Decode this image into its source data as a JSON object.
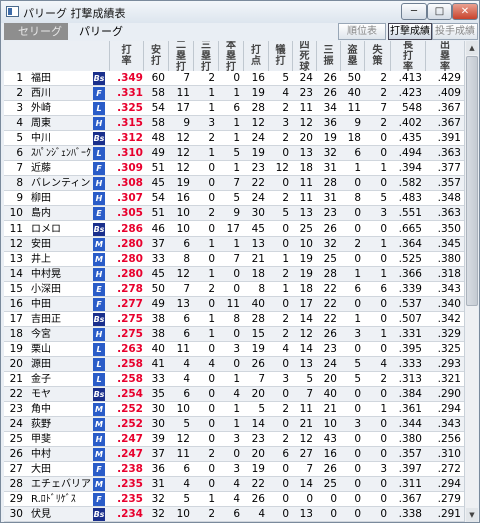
{
  "window": {
    "title": "パリーグ 打撃成績表",
    "min": "─",
    "max": "□",
    "close": "✕"
  },
  "toolbar": {
    "rank_table": "順位表",
    "batting": "打撃成績",
    "pitching": "投手成績"
  },
  "league": {
    "selector": "セリーグ",
    "current": "パリーグ"
  },
  "columns": [
    "打率",
    "安打",
    "二塁打",
    "三塁打",
    "本塁打",
    "打点",
    "犠打",
    "四死球",
    "三振",
    "盗塁",
    "失策",
    "長打率",
    "出塁率"
  ],
  "pos_colors": {
    "Bs": "#1a2f8c",
    "F": "#2a5cc8",
    "L": "#2a5cc8",
    "H": "#2a5cc8",
    "E": "#2a5cc8",
    "M": "#2a5cc8"
  },
  "rows": [
    {
      "rank": "1",
      "name": "福田",
      "team": "Bs",
      "avg": ".349",
      "v": [
        "60",
        "7",
        "2",
        "0",
        "16",
        "5",
        "24",
        "26",
        "50",
        "2",
        ".413",
        ".429"
      ]
    },
    {
      "rank": "2",
      "name": "西川",
      "team": "F",
      "avg": ".331",
      "v": [
        "58",
        "11",
        "1",
        "1",
        "19",
        "4",
        "23",
        "26",
        "40",
        "2",
        ".423",
        ".409"
      ]
    },
    {
      "rank": "3",
      "name": "外崎",
      "team": "L",
      "avg": ".325",
      "v": [
        "54",
        "17",
        "1",
        "6",
        "28",
        "2",
        "11",
        "34",
        "11",
        "7",
        "548",
        ".367"
      ]
    },
    {
      "rank": "4",
      "name": "周東",
      "team": "H",
      "avg": ".315",
      "v": [
        "58",
        "9",
        "3",
        "1",
        "12",
        "3",
        "12",
        "36",
        "9",
        "2",
        ".402",
        ".367"
      ]
    },
    {
      "rank": "5",
      "name": "中川",
      "team": "Bs",
      "avg": ".312",
      "v": [
        "48",
        "12",
        "2",
        "1",
        "24",
        "2",
        "20",
        "19",
        "18",
        "0",
        ".435",
        ".391"
      ]
    },
    {
      "rank": "6",
      "name": "ｽﾊﾟﾝｼﾞｪﾝﾊﾞｰｸﾞ",
      "team": "L",
      "avg": ".310",
      "v": [
        "49",
        "12",
        "1",
        "5",
        "19",
        "0",
        "13",
        "32",
        "6",
        "0",
        ".494",
        ".363"
      ]
    },
    {
      "rank": "7",
      "name": "近藤",
      "team": "F",
      "avg": ".309",
      "v": [
        "51",
        "12",
        "0",
        "1",
        "23",
        "12",
        "18",
        "31",
        "1",
        "1",
        ".394",
        ".377"
      ]
    },
    {
      "rank": "8",
      "name": "バレンティン",
      "team": "H",
      "avg": ".308",
      "v": [
        "45",
        "19",
        "0",
        "7",
        "22",
        "0",
        "11",
        "28",
        "0",
        "0",
        ".582",
        ".357"
      ]
    },
    {
      "rank": "9",
      "name": "柳田",
      "team": "H",
      "avg": ".307",
      "v": [
        "54",
        "16",
        "0",
        "5",
        "24",
        "2",
        "11",
        "31",
        "8",
        "5",
        ".483",
        ".348"
      ]
    },
    {
      "rank": "10",
      "name": "島内",
      "team": "E",
      "avg": ".305",
      "v": [
        "51",
        "10",
        "2",
        "9",
        "30",
        "5",
        "13",
        "23",
        "0",
        "3",
        ".551",
        ".363"
      ]
    },
    {
      "rank": "11",
      "name": "ロメロ",
      "team": "Bs",
      "avg": ".286",
      "v": [
        "46",
        "10",
        "0",
        "17",
        "45",
        "0",
        "25",
        "26",
        "0",
        "0",
        ".665",
        ".350"
      ]
    },
    {
      "rank": "12",
      "name": "安田",
      "team": "M",
      "avg": ".280",
      "v": [
        "37",
        "6",
        "1",
        "1",
        "13",
        "0",
        "10",
        "32",
        "2",
        "1",
        ".364",
        ".345"
      ]
    },
    {
      "rank": "13",
      "name": "井上",
      "team": "M",
      "avg": ".280",
      "v": [
        "33",
        "8",
        "0",
        "7",
        "21",
        "1",
        "19",
        "25",
        "0",
        "0",
        ".525",
        ".380"
      ]
    },
    {
      "rank": "14",
      "name": "中村晃",
      "team": "H",
      "avg": ".280",
      "v": [
        "45",
        "12",
        "1",
        "0",
        "18",
        "2",
        "19",
        "28",
        "1",
        "1",
        ".366",
        ".318"
      ]
    },
    {
      "rank": "15",
      "name": "小深田",
      "team": "E",
      "avg": ".278",
      "v": [
        "50",
        "7",
        "2",
        "0",
        "8",
        "1",
        "18",
        "22",
        "6",
        "6",
        ".339",
        ".343"
      ]
    },
    {
      "rank": "16",
      "name": "中田",
      "team": "F",
      "avg": ".277",
      "v": [
        "49",
        "13",
        "0",
        "11",
        "40",
        "0",
        "17",
        "22",
        "0",
        "0",
        ".537",
        ".340"
      ]
    },
    {
      "rank": "17",
      "name": "吉田正",
      "team": "Bs",
      "avg": ".275",
      "v": [
        "38",
        "6",
        "1",
        "8",
        "28",
        "2",
        "14",
        "22",
        "1",
        "0",
        ".507",
        ".342"
      ]
    },
    {
      "rank": "18",
      "name": "今宮",
      "team": "H",
      "avg": ".275",
      "v": [
        "38",
        "6",
        "1",
        "0",
        "15",
        "2",
        "12",
        "26",
        "3",
        "1",
        ".331",
        ".329"
      ]
    },
    {
      "rank": "19",
      "name": "栗山",
      "team": "L",
      "avg": ".263",
      "v": [
        "40",
        "11",
        "0",
        "3",
        "19",
        "4",
        "14",
        "23",
        "0",
        "0",
        ".395",
        ".325"
      ]
    },
    {
      "rank": "20",
      "name": "源田",
      "team": "L",
      "avg": ".258",
      "v": [
        "41",
        "4",
        "4",
        "0",
        "26",
        "0",
        "13",
        "24",
        "5",
        "4",
        ".333",
        ".293"
      ]
    },
    {
      "rank": "21",
      "name": "金子",
      "team": "L",
      "avg": ".258",
      "v": [
        "33",
        "4",
        "0",
        "1",
        "7",
        "3",
        "5",
        "20",
        "5",
        "2",
        ".313",
        ".321"
      ]
    },
    {
      "rank": "22",
      "name": "モヤ",
      "team": "Bs",
      "avg": ".254",
      "v": [
        "35",
        "6",
        "0",
        "4",
        "20",
        "0",
        "7",
        "40",
        "0",
        "0",
        ".384",
        ".290"
      ]
    },
    {
      "rank": "23",
      "name": "角中",
      "team": "M",
      "avg": ".252",
      "v": [
        "30",
        "10",
        "0",
        "1",
        "5",
        "2",
        "11",
        "21",
        "0",
        "1",
        ".361",
        ".294"
      ]
    },
    {
      "rank": "24",
      "name": "荻野",
      "team": "M",
      "avg": ".252",
      "v": [
        "30",
        "5",
        "0",
        "1",
        "14",
        "0",
        "21",
        "10",
        "3",
        "0",
        ".344",
        ".343"
      ]
    },
    {
      "rank": "25",
      "name": "甲斐",
      "team": "H",
      "avg": ".247",
      "v": [
        "39",
        "12",
        "0",
        "3",
        "23",
        "2",
        "12",
        "43",
        "0",
        "0",
        ".380",
        ".256"
      ]
    },
    {
      "rank": "26",
      "name": "中村",
      "team": "M",
      "avg": ".247",
      "v": [
        "37",
        "11",
        "2",
        "0",
        "20",
        "6",
        "27",
        "16",
        "0",
        "0",
        ".357",
        ".310"
      ]
    },
    {
      "rank": "27",
      "name": "大田",
      "team": "F",
      "avg": ".238",
      "v": [
        "36",
        "6",
        "0",
        "3",
        "19",
        "0",
        "7",
        "26",
        "0",
        "3",
        ".397",
        ".272"
      ]
    },
    {
      "rank": "28",
      "name": "エチェバリア",
      "team": "M",
      "avg": ".235",
      "v": [
        "31",
        "4",
        "0",
        "4",
        "22",
        "0",
        "14",
        "25",
        "0",
        "0",
        ".311",
        ".294"
      ]
    },
    {
      "rank": "29",
      "name": "R.ﾛﾄﾞﾘｹﾞｽ",
      "team": "F",
      "avg": ".235",
      "v": [
        "32",
        "5",
        "1",
        "4",
        "26",
        "0",
        "0",
        "0",
        "0",
        "0",
        ".367",
        ".279"
      ]
    },
    {
      "rank": "30",
      "name": "伏見",
      "team": "Bs",
      "avg": ".234",
      "v": [
        "32",
        "10",
        "2",
        "6",
        "4",
        "0",
        "13",
        "0",
        "0",
        "0",
        ".338",
        ".291"
      ]
    }
  ]
}
